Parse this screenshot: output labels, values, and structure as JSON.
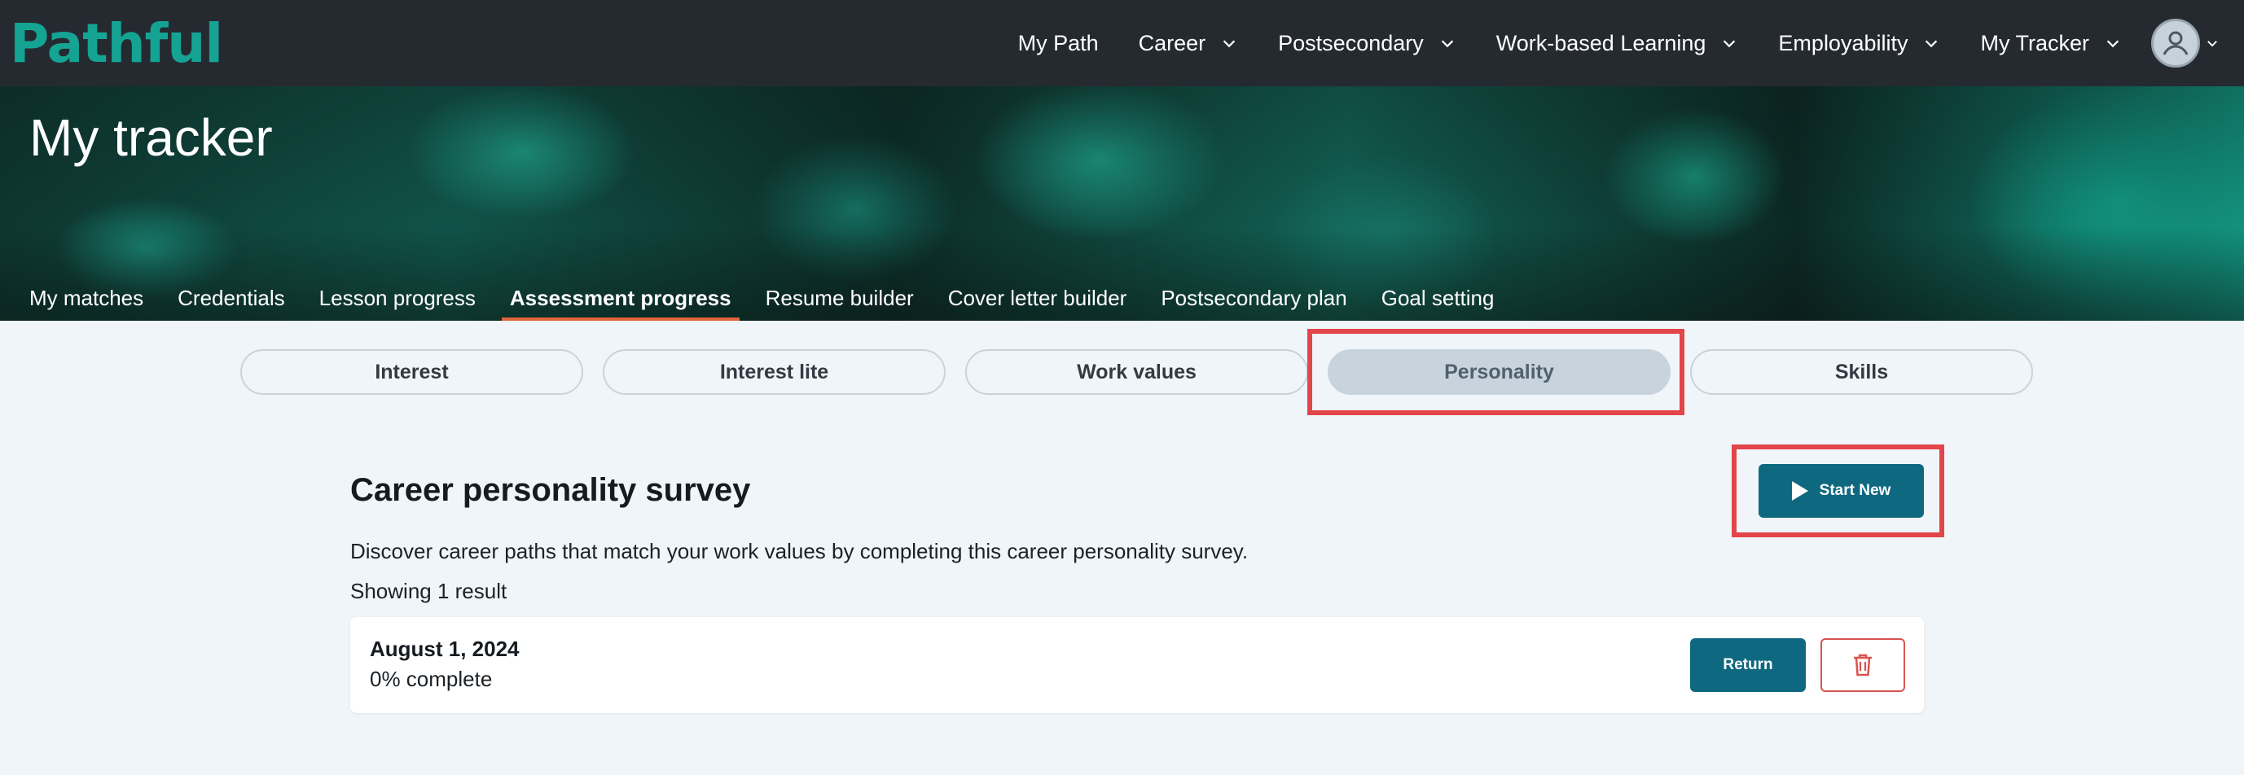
{
  "brand": {
    "logo_text": "Pathful",
    "accent": "#15a493"
  },
  "topnav": {
    "items": [
      {
        "label": "My Path",
        "has_dropdown": false
      },
      {
        "label": "Career",
        "has_dropdown": true
      },
      {
        "label": "Postsecondary",
        "has_dropdown": true
      },
      {
        "label": "Work-based Learning",
        "has_dropdown": true
      },
      {
        "label": "Employability",
        "has_dropdown": true
      },
      {
        "label": "My Tracker",
        "has_dropdown": true
      }
    ],
    "avatar_icon": "user-circle-icon"
  },
  "hero": {
    "title": "My tracker",
    "tabs": [
      {
        "label": "My matches"
      },
      {
        "label": "Credentials"
      },
      {
        "label": "Lesson progress"
      },
      {
        "label": "Assessment progress",
        "active": true
      },
      {
        "label": "Resume builder"
      },
      {
        "label": "Cover letter builder"
      },
      {
        "label": "Postsecondary plan"
      },
      {
        "label": "Goal setting"
      }
    ]
  },
  "assessment_tabs": [
    {
      "label": "Interest"
    },
    {
      "label": "Interest lite"
    },
    {
      "label": "Work values"
    },
    {
      "label": "Personality",
      "active": true
    },
    {
      "label": "Skills"
    }
  ],
  "survey": {
    "title": "Career personality survey",
    "start_label": "Start New",
    "description": "Discover career paths that match your work values by completing this career personality survey.",
    "result_count": "Showing 1 result"
  },
  "results": [
    {
      "date": "August 1, 2024",
      "progress": "0% complete",
      "return_label": "Return"
    }
  ],
  "colors": {
    "primary_button": "#0e6880",
    "delete": "#d9534f",
    "highlight": "#e2454a",
    "active_tab_underline": "#e2643a"
  }
}
